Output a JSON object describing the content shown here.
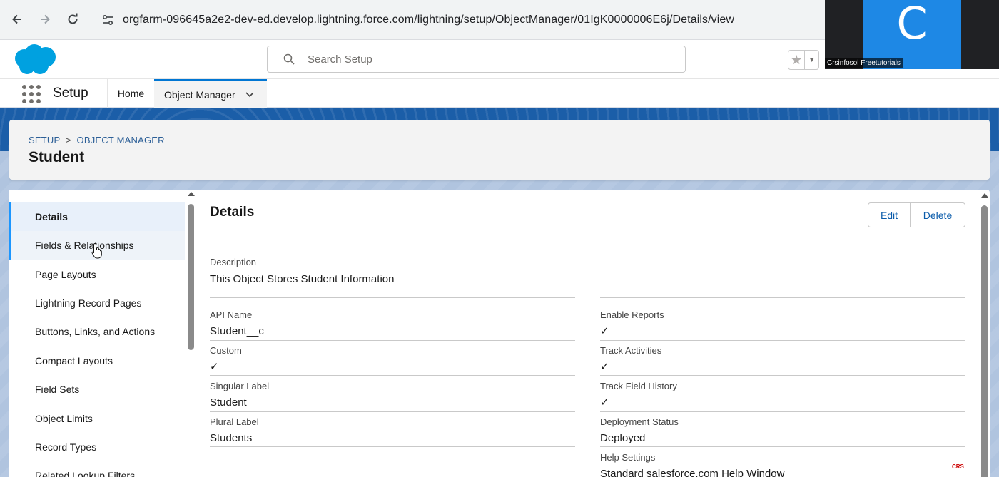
{
  "browser": {
    "url": "orgfarm-096645a2e2-dev-ed.develop.lightning.force.com/lightning/setup/ObjectManager/01IgK0000006E6j/Details/view"
  },
  "header": {
    "search_placeholder": "Search Setup"
  },
  "video": {
    "initial": "C",
    "name": "Crsinfosol Freetutorials"
  },
  "app_nav": {
    "app_name": "Setup",
    "home": "Home",
    "object_manager": "Object Manager"
  },
  "page": {
    "breadcrumb_1": "SETUP",
    "breadcrumb_sep": ">",
    "breadcrumb_2": "OBJECT MANAGER",
    "title": "Student"
  },
  "sidebar": {
    "items": [
      {
        "label": "Details"
      },
      {
        "label": "Fields & Relationships"
      },
      {
        "label": "Page Layouts"
      },
      {
        "label": "Lightning Record Pages"
      },
      {
        "label": "Buttons, Links, and Actions"
      },
      {
        "label": "Compact Layouts"
      },
      {
        "label": "Field Sets"
      },
      {
        "label": "Object Limits"
      },
      {
        "label": "Record Types"
      },
      {
        "label": "Related Lookup Filters"
      }
    ]
  },
  "details": {
    "title": "Details",
    "edit": "Edit",
    "delete": "Delete",
    "description_label": "Description",
    "description_value": "This Object Stores Student Information",
    "left": [
      {
        "label": "API Name",
        "value": "Student__c"
      },
      {
        "label": "Custom",
        "value": "✓"
      },
      {
        "label": "Singular Label",
        "value": "Student"
      },
      {
        "label": "Plural Label",
        "value": "Students"
      }
    ],
    "right": [
      {
        "label": "Enable Reports",
        "value": "✓"
      },
      {
        "label": "Track Activities",
        "value": "✓"
      },
      {
        "label": "Track Field History",
        "value": "✓"
      },
      {
        "label": "Deployment Status",
        "value": "Deployed"
      },
      {
        "label": "Help Settings",
        "value": "Standard salesforce.com Help Window"
      }
    ]
  },
  "watermark": "CRS"
}
